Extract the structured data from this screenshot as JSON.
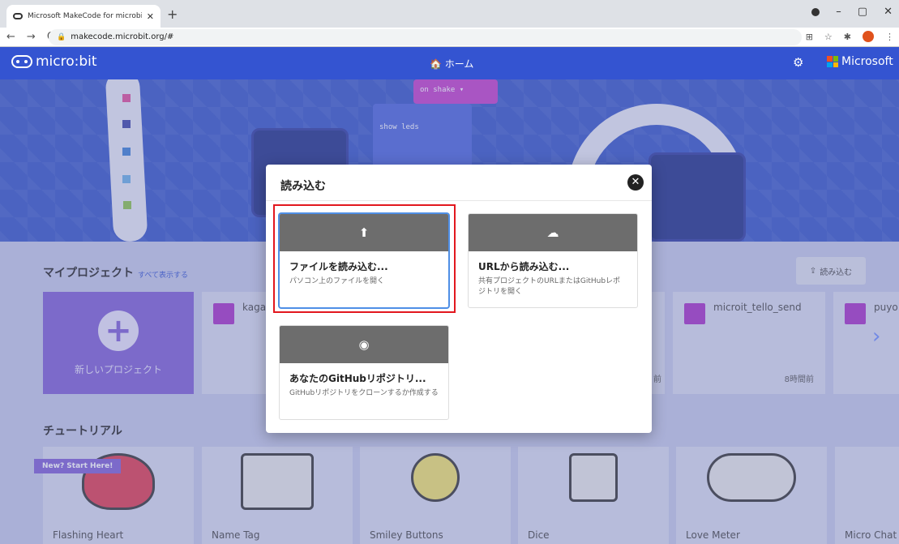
{
  "browser": {
    "tab_title": "Microsoft MakeCode for microbit",
    "tab_close": "✕",
    "new_tab": "+",
    "url": "makecode.microbit.org/#",
    "nav": {
      "back": "←",
      "forward": "→",
      "reload": "C"
    },
    "window_controls": {
      "minimize": "–",
      "maximize": "▢",
      "close": "✕"
    }
  },
  "app": {
    "logo_text": "micro:bit",
    "home_label": "ホーム",
    "home_icon": "home-icon",
    "brand": "Microsoft"
  },
  "banner": {
    "block_event": "on  shake ▾",
    "block_show_leds": "show leds"
  },
  "my_projects": {
    "title": "マイプロジェクト",
    "show_all": "すべて表示する",
    "import_label": "読み込む",
    "new_project_label": "新しいプロジェクト",
    "projects": [
      {
        "name": "kaga",
        "time": ""
      },
      {
        "name": "",
        "time": "前"
      },
      {
        "name": "microit_tello_send",
        "time": "8時間前"
      },
      {
        "name": "puyo",
        "time": ""
      }
    ],
    "next_arrow": "›"
  },
  "tutorials": {
    "title": "チュートリアル",
    "badge": "New? Start Here!",
    "items": [
      {
        "name": "Flashing Heart"
      },
      {
        "name": "Name Tag"
      },
      {
        "name": "Smiley Buttons"
      },
      {
        "name": "Dice"
      },
      {
        "name": "Love Meter"
      },
      {
        "name": "Micro Chat"
      }
    ]
  },
  "modal": {
    "title": "読み込む",
    "close_icon": "close-icon",
    "options": [
      {
        "name": "ファイルを読み込む...",
        "desc": "パソコン上のファイルを開く",
        "icon": "upload-icon"
      },
      {
        "name": "URLから読み込む...",
        "desc": "共有プロジェクトのURLまたはGitHubレポジトリを開く",
        "icon": "cloud-download-icon"
      },
      {
        "name": "あなたのGitHubリポジトリ...",
        "desc": "GitHubリポジトリをクローンするか作成する",
        "icon": "github-icon"
      }
    ]
  },
  "colors": {
    "accent": "#3454d1",
    "purple": "#7e5fd6",
    "highlight": "#e2171e"
  }
}
